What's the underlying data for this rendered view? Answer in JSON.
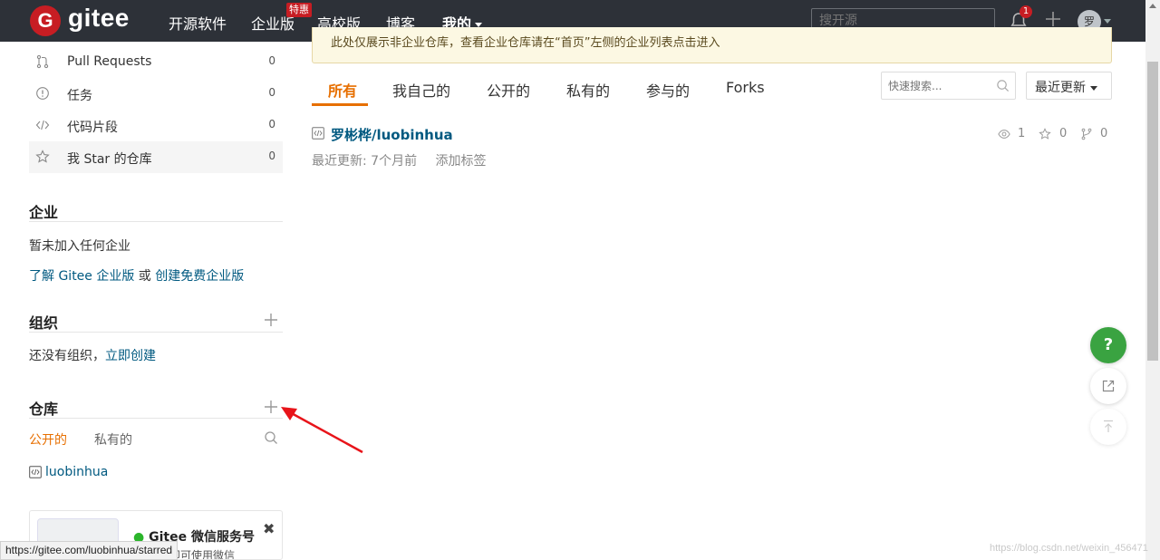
{
  "nav": {
    "logo_letter": "G",
    "brand": "gitee",
    "items": [
      "开源软件",
      "企业版",
      "高校版",
      "博客",
      "我的"
    ],
    "badge": "特惠",
    "search_placeholder": "搜开源",
    "notification_count": "1",
    "avatar_text": "罗"
  },
  "sidebar": {
    "items": [
      {
        "label": "Pull Requests",
        "count": "0"
      },
      {
        "label": "任务",
        "count": "0"
      },
      {
        "label": "代码片段",
        "count": "0"
      },
      {
        "label": "我 Star 的仓库",
        "count": "0"
      }
    ],
    "enterprise": {
      "title": "企业",
      "empty": "暂未加入任何企业",
      "learn_link": "了解 Gitee 企业版",
      "or": " 或 ",
      "create_link": "创建免费企业版"
    },
    "org": {
      "title": "组织",
      "empty": "还没有组织，",
      "create_link": "立即创建"
    },
    "repos": {
      "title": "仓库",
      "tabs": [
        "公开的",
        "私有的"
      ],
      "items": [
        "luobinhua"
      ]
    },
    "wechat": {
      "title": "Gitee 微信服务号",
      "subtitle": "号，即可使用微信"
    }
  },
  "status_url": "https://gitee.com/luobinhua/starred",
  "main": {
    "notice": "此处仅展示非企业仓库，查看企业仓库请在“首页”左侧的企业列表点击进入",
    "tabs": [
      "所有",
      "我自己的",
      "公开的",
      "私有的",
      "参与的",
      "Forks"
    ],
    "quick_search_placeholder": "快速搜索...",
    "sort_label": "最近更新",
    "repo": {
      "name": "罗彬桦/luobinhua",
      "updated": "最近更新: 7个月前",
      "add_tag": "添加标签",
      "watch": "1",
      "star": "0",
      "fork": "0"
    }
  },
  "floating": {
    "help": "?"
  },
  "watermark": "https://blog.csdn.net/weixin_456471",
  "colors": {
    "accent": "#e76f00",
    "link": "#005980",
    "brand": "#c71d23",
    "nav_bg": "#2d3138",
    "help_green": "#3aa341"
  }
}
